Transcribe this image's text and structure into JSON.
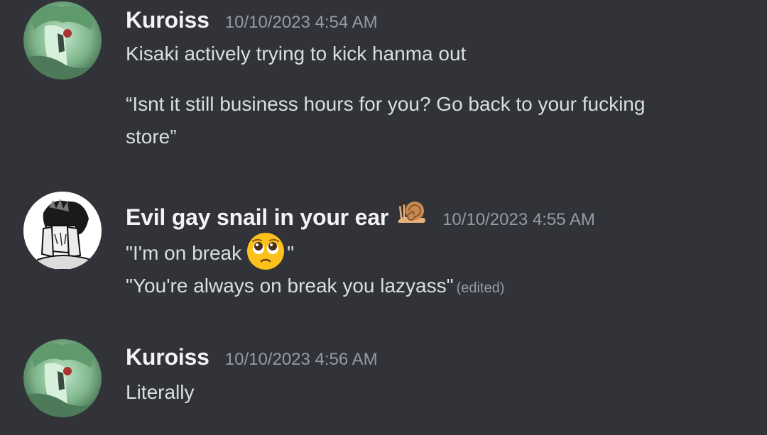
{
  "messages": [
    {
      "username": "Kuroiss",
      "timestamp": "10/10/2023 4:54 AM",
      "avatar_icon": "anime-avatar-green",
      "lines": [
        "Kisaki actively trying to kick hanma out",
        "“Isnt it still business hours for you? Go back to your fucking",
        "store”"
      ]
    },
    {
      "username": "Evil gay snail in your ear",
      "username_emoji": "snail-icon",
      "timestamp": "10/10/2023 4:55 AM",
      "avatar_icon": "manga-avatar-bw",
      "lines": [
        {
          "before": "\"I'm on break",
          "emoji": "pleading-face-icon",
          "after": "\""
        },
        {
          "text": "\"You're always on break you lazyass\"",
          "edited": "(edited)"
        }
      ]
    },
    {
      "username": "Kuroiss",
      "timestamp": "10/10/2023 4:56 AM",
      "avatar_icon": "anime-avatar-green",
      "lines": [
        "Literally"
      ]
    }
  ],
  "colors": {
    "background": "#313338",
    "username": "#f2f3f5",
    "text": "#dbdee1",
    "muted": "#949ba4"
  }
}
